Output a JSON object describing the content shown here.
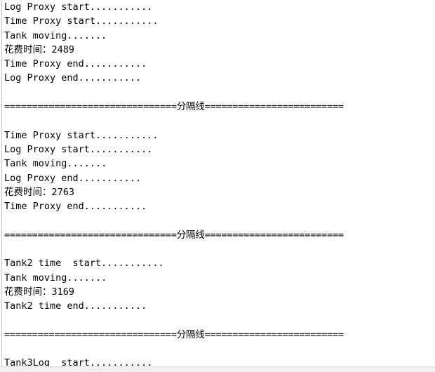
{
  "console": {
    "title": "console-output",
    "font_color": "#000000",
    "background_color": "#ffffff",
    "border_color": "#c8c8c8",
    "lines": [
      {
        "text": "Log Proxy start..........."
      },
      {
        "text": "Time Proxy start..........."
      },
      {
        "text": "Tank moving......."
      },
      {
        "text": "花费时间：2489"
      },
      {
        "text": "Time Proxy end..........."
      },
      {
        "text": "Log Proxy end..........."
      },
      {
        "text": ""
      },
      {
        "text": "===============================分隔线========================="
      },
      {
        "text": ""
      },
      {
        "text": "Time Proxy start..........."
      },
      {
        "text": "Log Proxy start..........."
      },
      {
        "text": "Tank moving......."
      },
      {
        "text": "Log Proxy end..........."
      },
      {
        "text": "花费时间：2763"
      },
      {
        "text": "Time Proxy end..........."
      },
      {
        "text": ""
      },
      {
        "text": "===============================分隔线========================="
      },
      {
        "text": ""
      },
      {
        "text": "Tank2 time  start..........."
      },
      {
        "text": "Tank moving......."
      },
      {
        "text": "花费时间：3169"
      },
      {
        "text": "Tank2 time end..........."
      },
      {
        "text": ""
      },
      {
        "text": "===============================分隔线========================="
      },
      {
        "text": ""
      },
      {
        "text": "Tank3Log  start..........."
      }
    ]
  }
}
